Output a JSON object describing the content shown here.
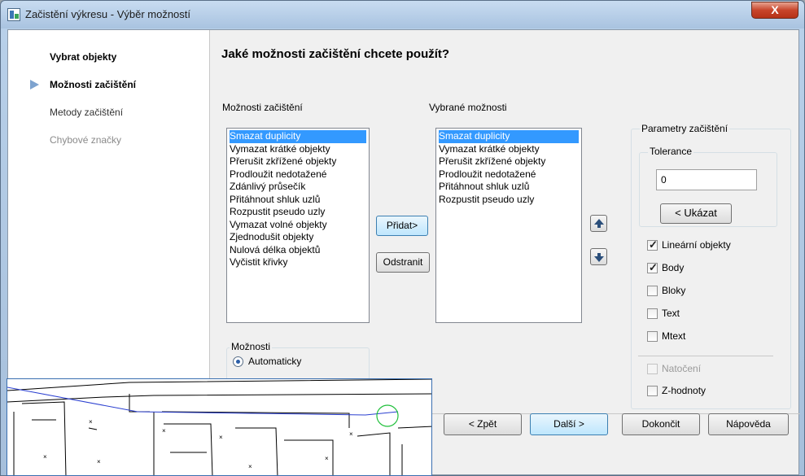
{
  "window": {
    "title": "Začistění výkresu - Výběr možností",
    "close_label": "X"
  },
  "steps": [
    {
      "label": "Vybrat objekty"
    },
    {
      "label": "Možnosti začištění"
    },
    {
      "label": "Metody začištění"
    },
    {
      "label": "Chybové značky"
    }
  ],
  "heading": "Jaké možnosti začištění chcete použít?",
  "available": {
    "label": "Možnosti začištění",
    "items": [
      "Smazat duplicity",
      "Vymazat krátké objekty",
      "Přerušit zkřížené objekty",
      "Prodloužit nedotažené",
      "Zdánlivý průsečík",
      "Přitáhnout shluk uzlů",
      "Rozpustit pseudo uzly",
      "Vymazat volné objekty",
      "Zjednodušit objekty",
      "Nulová délka objektů",
      "Vyčistit křivky"
    ]
  },
  "selected": {
    "label": "Vybrané možnosti",
    "items": [
      "Smazat duplicity",
      "Vymazat krátké objekty",
      "Přerušit zkřížené objekty",
      "Prodloužit nedotažené",
      "Přitáhnout shluk uzlů",
      "Rozpustit pseudo uzly"
    ]
  },
  "buttons": {
    "add": "Přidat>",
    "remove": "Odstranit",
    "back": "< Zpět",
    "next": "Další >",
    "finish": "Dokončit",
    "help": "Nápověda"
  },
  "options_group": {
    "label": "Možnosti",
    "auto": "Automaticky"
  },
  "params": {
    "label": "Parametry začištění",
    "tolerance_label": "Tolerance",
    "tolerance_value": "0",
    "show_label": "< Ukázat",
    "checks": [
      {
        "label": "Lineární objekty",
        "checked": true,
        "enabled": true
      },
      {
        "label": "Body",
        "checked": true,
        "enabled": true
      },
      {
        "label": "Bloky",
        "checked": false,
        "enabled": true
      },
      {
        "label": "Text",
        "checked": false,
        "enabled": true
      },
      {
        "label": "Mtext",
        "checked": false,
        "enabled": true
      },
      {
        "label": "Natočení",
        "checked": false,
        "enabled": false
      },
      {
        "label": "Z-hodnoty",
        "checked": false,
        "enabled": true
      }
    ]
  }
}
